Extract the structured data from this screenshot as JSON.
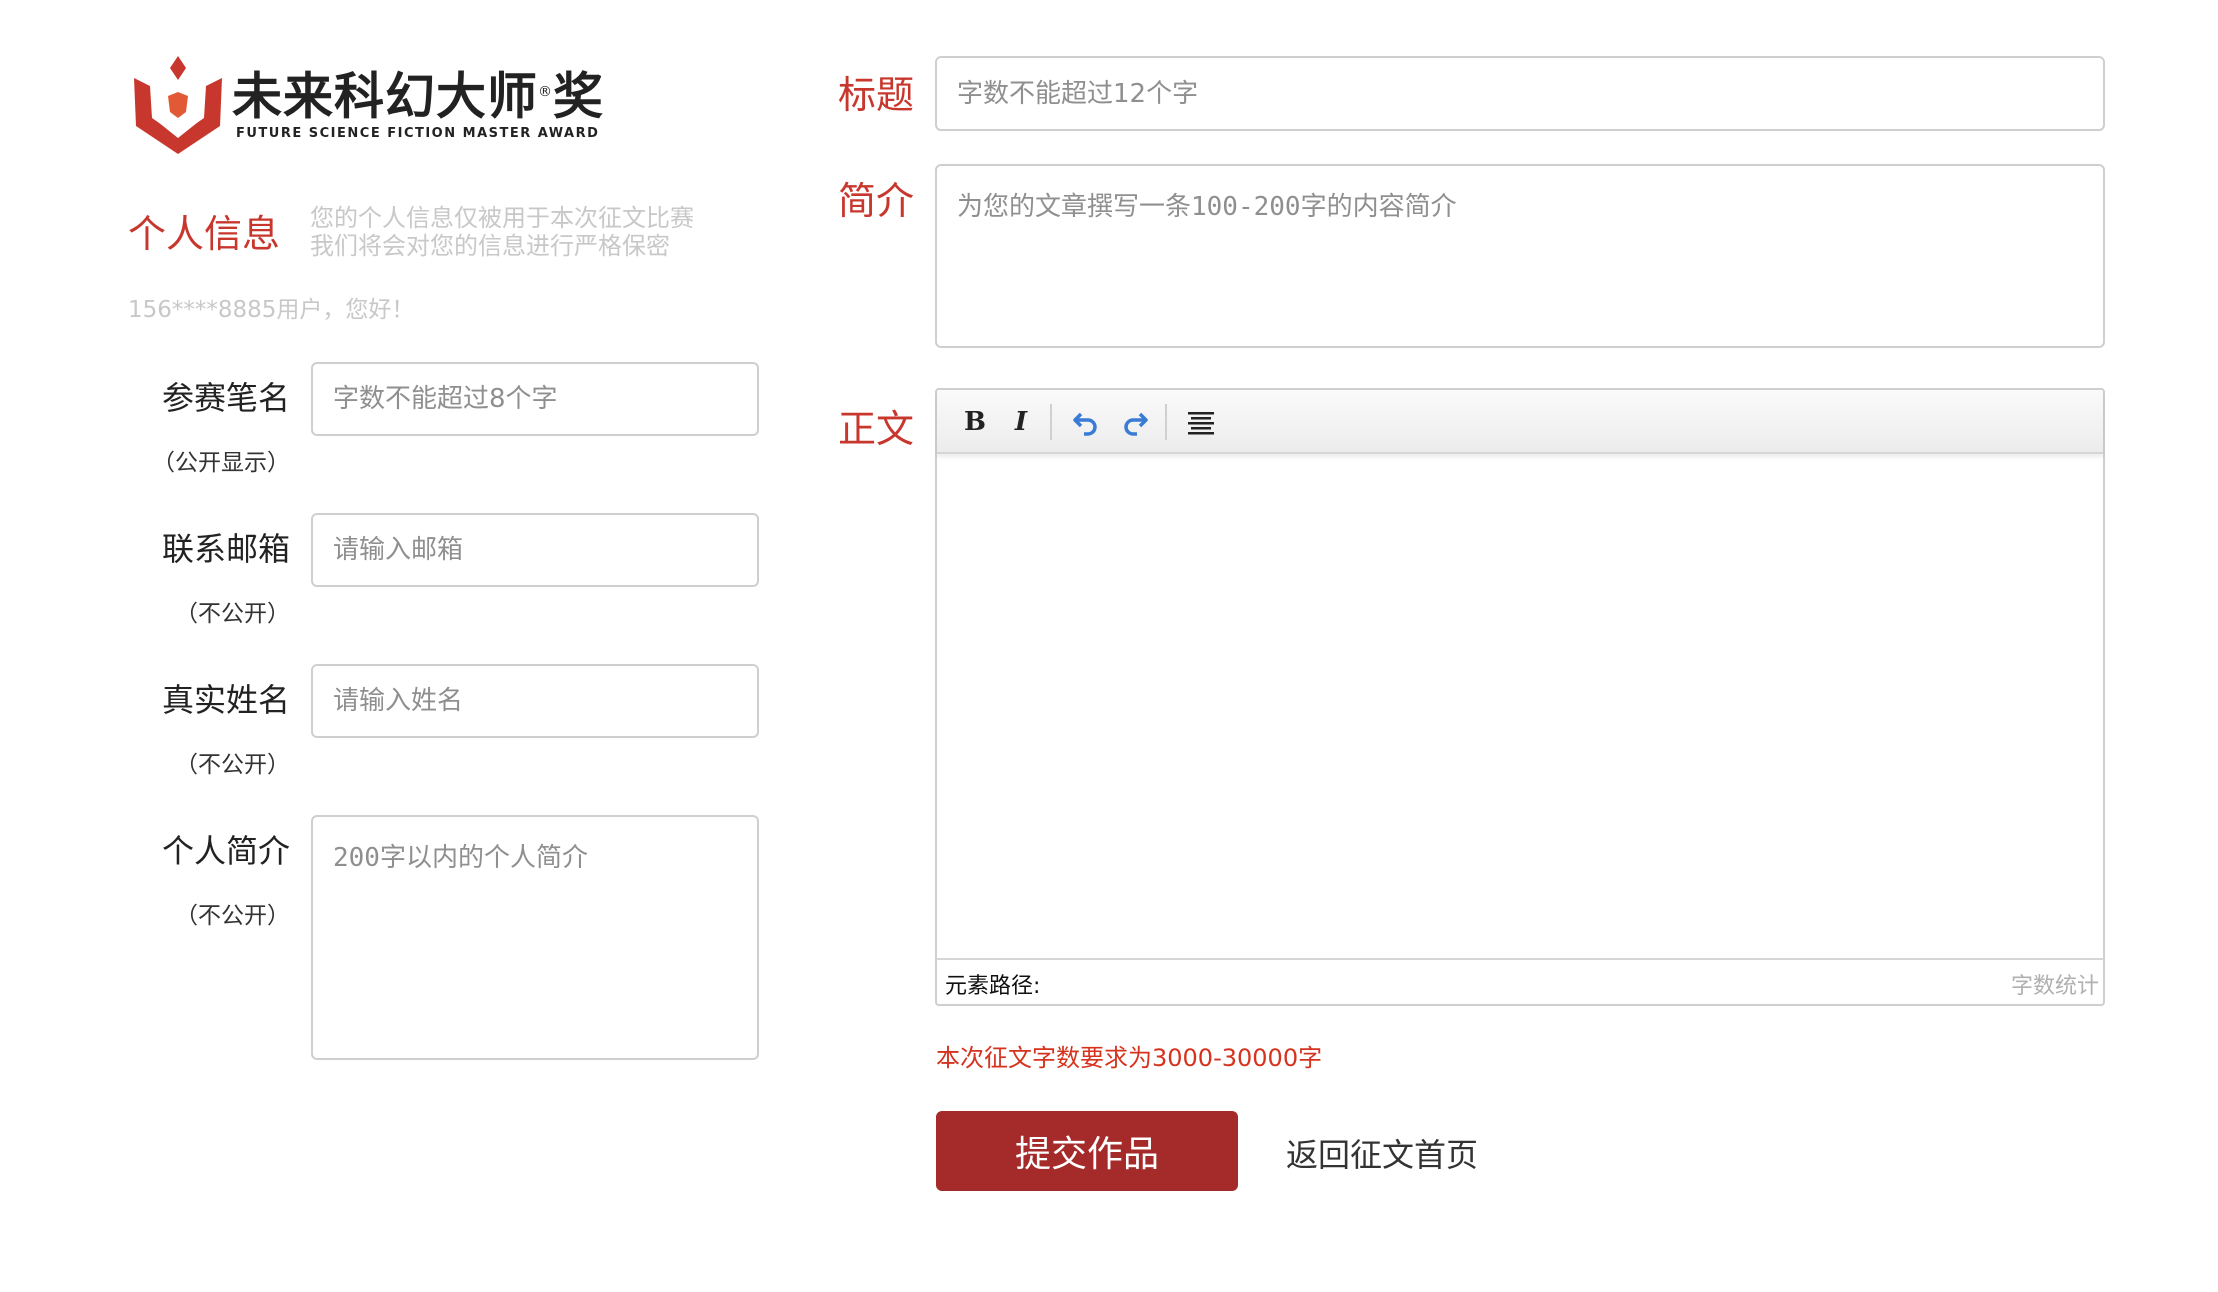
{
  "brand": {
    "name_cn": "未来科幻大师",
    "trademark": "®",
    "name_suffix": "奖",
    "name_en": "FUTURE SCIENCE FICTION MASTER AWARD",
    "accent_color": "#c8372d"
  },
  "personal_info": {
    "title": "个人信息",
    "privacy_line1": "您的个人信息仅被用于本次征文比赛",
    "privacy_line2": "我们将会对您的信息进行严格保密",
    "greeting": "156****8885用户，您好！"
  },
  "fields": {
    "pen_name": {
      "label": "参赛笔名",
      "note": "（公开显示）",
      "placeholder": "字数不能超过8个字",
      "value": ""
    },
    "email": {
      "label": "联系邮箱",
      "note": "（不公开）",
      "placeholder": "请输入邮箱",
      "value": ""
    },
    "real_name": {
      "label": "真实姓名",
      "note": "（不公开）",
      "placeholder": "请输入姓名",
      "value": ""
    },
    "bio": {
      "label": "个人简介",
      "note": "（不公开）",
      "placeholder": "200字以内的个人简介",
      "value": ""
    }
  },
  "work": {
    "title_label": "标题",
    "title_placeholder": "字数不能超过12个字",
    "summary_label": "简介",
    "summary_placeholder": "为您的文章撰写一条100-200字的内容简介",
    "body_label": "正文"
  },
  "editor": {
    "toolbar": {
      "bold": "B",
      "italic": "I",
      "undo_icon": "undo-icon",
      "redo_icon": "redo-icon",
      "align_icon": "justify-icon"
    },
    "element_path_label": "元素路径:",
    "word_count_label": "字数统计"
  },
  "requirement_note": "本次征文字数要求为3000-30000字",
  "actions": {
    "submit": "提交作品",
    "back": "返回征文首页",
    "submit_color": "#a52a2a"
  }
}
